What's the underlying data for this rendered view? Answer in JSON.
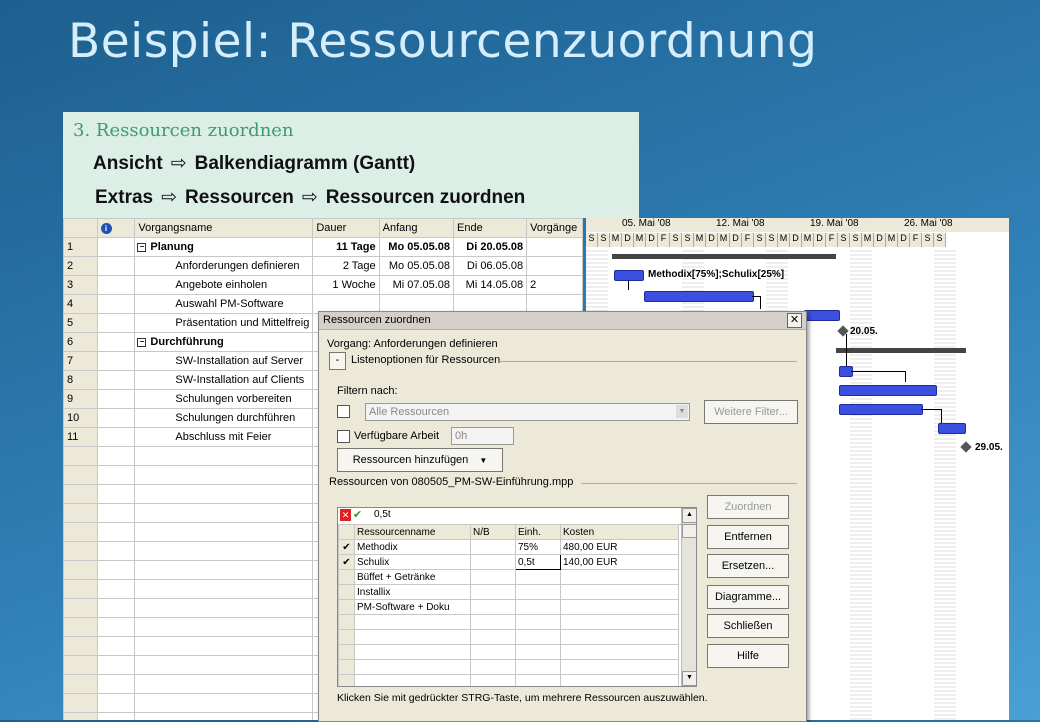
{
  "slide": {
    "title": "Beispiel: Ressourcenzuordnung",
    "step": "3. Ressourcen zuordnen",
    "line1_a": "Ansicht",
    "line1_b": "Balkendiagramm (Gantt)",
    "line2_a": "Extras",
    "line2_b": "Ressourcen",
    "line2_c": "Ressourcen zuordnen",
    "arrow": "⇨"
  },
  "gantt_table": {
    "headers": [
      "Vorgangsname",
      "Dauer",
      "Anfang",
      "Ende",
      "Vorgänge"
    ],
    "rows": [
      {
        "id": "1",
        "name": "Planung",
        "dauer": "11 Tage",
        "anfang": "Mo 05.05.08",
        "ende": "Di 20.05.08",
        "vorg": "",
        "summary": true
      },
      {
        "id": "2",
        "name": "Anforderungen definieren",
        "dauer": "2 Tage",
        "anfang": "Mo 05.05.08",
        "ende": "Di 06.05.08",
        "vorg": ""
      },
      {
        "id": "3",
        "name": "Angebote einholen",
        "dauer": "1 Woche",
        "anfang": "Mi 07.05.08",
        "ende": "Mi 14.05.08",
        "vorg": "2"
      },
      {
        "id": "4",
        "name": "Auswahl PM-Software",
        "dauer": "",
        "anfang": "",
        "ende": "",
        "vorg": ""
      },
      {
        "id": "5",
        "name": "Präsentation und Mittelfreig",
        "dauer": "",
        "anfang": "",
        "ende": "",
        "vorg": ""
      },
      {
        "id": "6",
        "name": "Durchführung",
        "dauer": "",
        "anfang": "",
        "ende": "",
        "vorg": "",
        "summary": true
      },
      {
        "id": "7",
        "name": "SW-Installation auf Server",
        "dauer": "",
        "anfang": "",
        "ende": "",
        "vorg": ""
      },
      {
        "id": "8",
        "name": "SW-Installation auf Clients",
        "dauer": "",
        "anfang": "",
        "ende": "",
        "vorg": ""
      },
      {
        "id": "9",
        "name": "Schulungen vorbereiten",
        "dauer": "",
        "anfang": "",
        "ende": "",
        "vorg": ""
      },
      {
        "id": "10",
        "name": "Schulungen durchführen",
        "dauer": "",
        "anfang": "",
        "ende": "",
        "vorg": ""
      },
      {
        "id": "11",
        "name": "Abschluss mit Feier",
        "dauer": "",
        "anfang": "",
        "ende": "",
        "vorg": ""
      }
    ]
  },
  "gantt_chart": {
    "weeks": [
      "05. Mai '08",
      "12. Mai '08",
      "19. Mai '08",
      "26. Mai '08"
    ],
    "day_letters": [
      "S",
      "S",
      "M",
      "D",
      "M",
      "D",
      "F",
      "S",
      "S",
      "M",
      "D",
      "M",
      "D",
      "F",
      "S",
      "S",
      "M",
      "D",
      "M",
      "D",
      "F",
      "S",
      "S",
      "M",
      "D",
      "M",
      "D",
      "F",
      "S",
      "S"
    ],
    "bar_label": "Methodix[75%];Schulix[25%]",
    "milestone1": "20.05.",
    "milestone2": "29.05."
  },
  "dialog": {
    "title": "Ressourcen zuordnen",
    "close": "✕",
    "vorgang": "Vorgang: Anforderungen definieren",
    "listoptions_toggle": "-",
    "listoptions": "Listenoptionen für Ressourcen",
    "filter_label": "Filtern nach:",
    "filter_value": "Alle Ressourcen",
    "filter_more": "Weitere Filter...",
    "available_label": "Verfügbare Arbeit",
    "available_value": "0h",
    "add_button": "Ressourcen hinzufügen",
    "resources_from": "Ressourcen von 080505_PM-SW-Einführung.mpp",
    "edit_value": "0,5t",
    "col_headers": [
      "Ressourcenname",
      "N/B",
      "Einh.",
      "Kosten"
    ],
    "rows": [
      {
        "check": "✔",
        "name": "Methodix",
        "nb": "",
        "einh": "75%",
        "kosten": "480,00 EUR"
      },
      {
        "check": "✔",
        "name": "Schulix",
        "nb": "",
        "einh": "0,5t",
        "kosten": "140,00 EUR"
      },
      {
        "check": "",
        "name": "Büffet + Getränke",
        "nb": "",
        "einh": "",
        "kosten": ""
      },
      {
        "check": "",
        "name": "Installix",
        "nb": "",
        "einh": "",
        "kosten": ""
      },
      {
        "check": "",
        "name": "PM-Software + Doku",
        "nb": "",
        "einh": "",
        "kosten": ""
      }
    ],
    "buttons": {
      "zuordnen": "Zuordnen",
      "entfernen": "Entfernen",
      "ersetzen": "Ersetzen...",
      "diagramme": "Diagramme...",
      "schliessen": "Schließen",
      "hilfe": "Hilfe"
    },
    "hint": "Klicken Sie mit gedrückter STRG-Taste, um mehrere Ressourcen auszuwählen."
  }
}
